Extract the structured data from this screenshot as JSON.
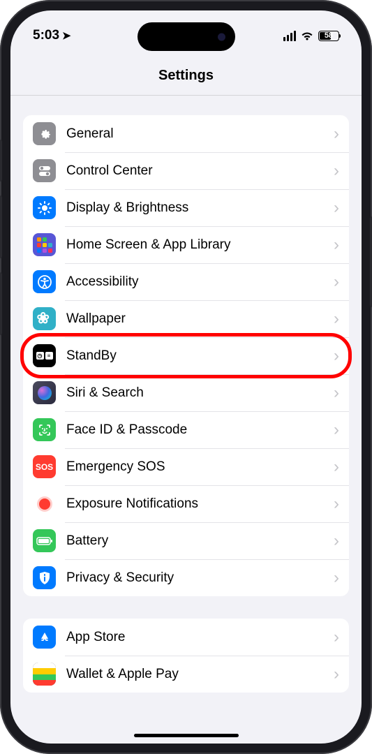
{
  "status": {
    "time": "5:03",
    "battery_pct": "58"
  },
  "nav": {
    "title": "Settings"
  },
  "sections": [
    {
      "rows": [
        {
          "id": "general",
          "label": "General",
          "icon": "gear",
          "highlighted": false
        },
        {
          "id": "control-center",
          "label": "Control Center",
          "icon": "cc",
          "highlighted": false
        },
        {
          "id": "display-brightness",
          "label": "Display & Brightness",
          "icon": "display",
          "highlighted": false
        },
        {
          "id": "home-screen",
          "label": "Home Screen & App Library",
          "icon": "home",
          "highlighted": false
        },
        {
          "id": "accessibility",
          "label": "Accessibility",
          "icon": "access",
          "highlighted": false
        },
        {
          "id": "wallpaper",
          "label": "Wallpaper",
          "icon": "wall",
          "highlighted": false
        },
        {
          "id": "standby",
          "label": "StandBy",
          "icon": "standby",
          "highlighted": true
        },
        {
          "id": "siri-search",
          "label": "Siri & Search",
          "icon": "siri",
          "highlighted": false
        },
        {
          "id": "face-id",
          "label": "Face ID & Passcode",
          "icon": "face",
          "highlighted": false
        },
        {
          "id": "emergency-sos",
          "label": "Emergency SOS",
          "icon": "sos",
          "highlighted": false
        },
        {
          "id": "exposure",
          "label": "Exposure Notifications",
          "icon": "expo",
          "highlighted": false
        },
        {
          "id": "battery",
          "label": "Battery",
          "icon": "batt",
          "highlighted": false
        },
        {
          "id": "privacy",
          "label": "Privacy & Security",
          "icon": "priv",
          "highlighted": false
        }
      ]
    },
    {
      "rows": [
        {
          "id": "app-store",
          "label": "App Store",
          "icon": "appstore",
          "highlighted": false
        },
        {
          "id": "wallet",
          "label": "Wallet & Apple Pay",
          "icon": "wallet",
          "highlighted": false
        }
      ]
    }
  ]
}
